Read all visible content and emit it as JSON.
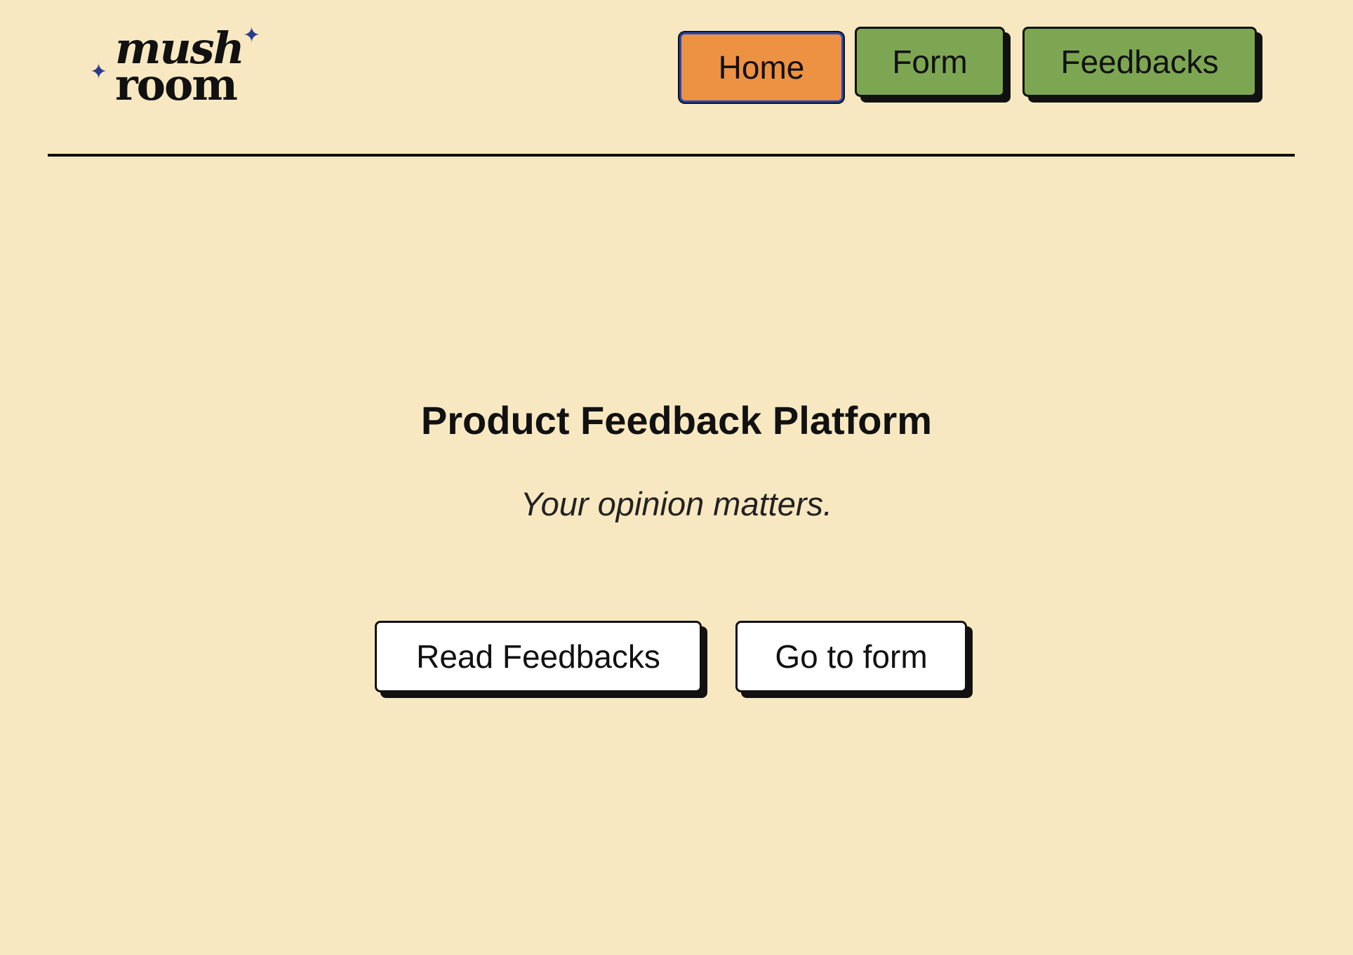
{
  "logo": {
    "line1": "mush",
    "line2": "room",
    "star_icon": "four-point-star",
    "star_color": "#2a3c8f"
  },
  "nav": {
    "items": [
      {
        "label": "Home",
        "active": true,
        "color": "#ed9142"
      },
      {
        "label": "Form",
        "active": false,
        "color": "#7da653"
      },
      {
        "label": "Feedbacks",
        "active": false,
        "color": "#7da653"
      }
    ]
  },
  "hero": {
    "title": "Product Feedback Platform",
    "subtitle": "Your opinion matters."
  },
  "actions": {
    "read_label": "Read Feedbacks",
    "form_label": "Go to form"
  },
  "colors": {
    "background": "#f8e8c1",
    "accent_orange": "#ed9142",
    "accent_green": "#7da653"
  }
}
